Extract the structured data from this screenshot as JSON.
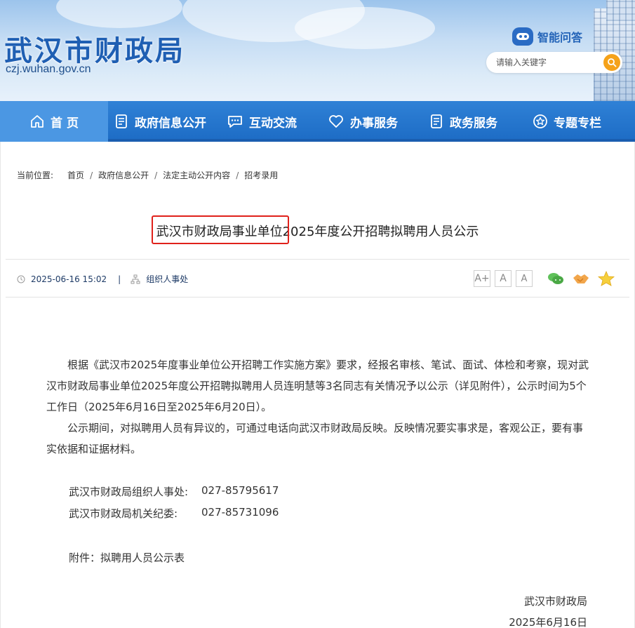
{
  "header": {
    "site_title": "武汉市财政局",
    "site_domain": "czj.wuhan.gov.cn",
    "ai_label": "智能问答",
    "search_placeholder": "请输入关键字"
  },
  "nav": {
    "items": [
      {
        "label": "首 页",
        "icon": "home-icon"
      },
      {
        "label": "政府信息公开",
        "icon": "document-icon"
      },
      {
        "label": "互动交流",
        "icon": "chat-icon"
      },
      {
        "label": "办事服务",
        "icon": "heart-icon"
      },
      {
        "label": "政务服务",
        "icon": "document-icon"
      },
      {
        "label": "专题专栏",
        "icon": "star-icon"
      }
    ]
  },
  "breadcrumb": {
    "prefix": "当前位置:",
    "items": [
      "首页",
      "政府信息公开",
      "法定主动公开内容",
      "招考录用"
    ]
  },
  "article": {
    "title": "武汉市财政局事业单位2025年度公开招聘拟聘用人员公示",
    "date": "2025-06-16 15:02",
    "department": "组织人事处",
    "font_sizes": [
      "A+",
      "A",
      "A"
    ],
    "paragraphs": [
      "根据《武汉市2025年度事业单位公开招聘工作实施方案》要求，经报名审核、笔试、面试、体检和考察，现对武汉市财政局事业单位2025年度公开招聘拟聘用人员连明慧等3名同志有关情况予以公示（详见附件），公示时间为5个工作日（2025年6月16日至2025年6月20日）。",
      "公示期间，对拟聘用人员有异议的，可通过电话向武汉市财政局反映。反映情况要实事求是，客观公正，要有事实依据和证据材料。"
    ],
    "contacts": [
      {
        "label": "武汉市财政局组织人事处:",
        "phone": "027-85795617"
      },
      {
        "label": "武汉市财政局机关纪委:",
        "phone": "027-85731096"
      }
    ],
    "attachment": "附件：拟聘用人员公示表",
    "signature": "武汉市财政局",
    "signature_date": "2025年6月16日"
  },
  "colors": {
    "brand_blue": "#1f5fb3",
    "nav_blue": "#2277cf",
    "highlight_red": "#e0211b",
    "search_orange": "#f5a21a"
  }
}
